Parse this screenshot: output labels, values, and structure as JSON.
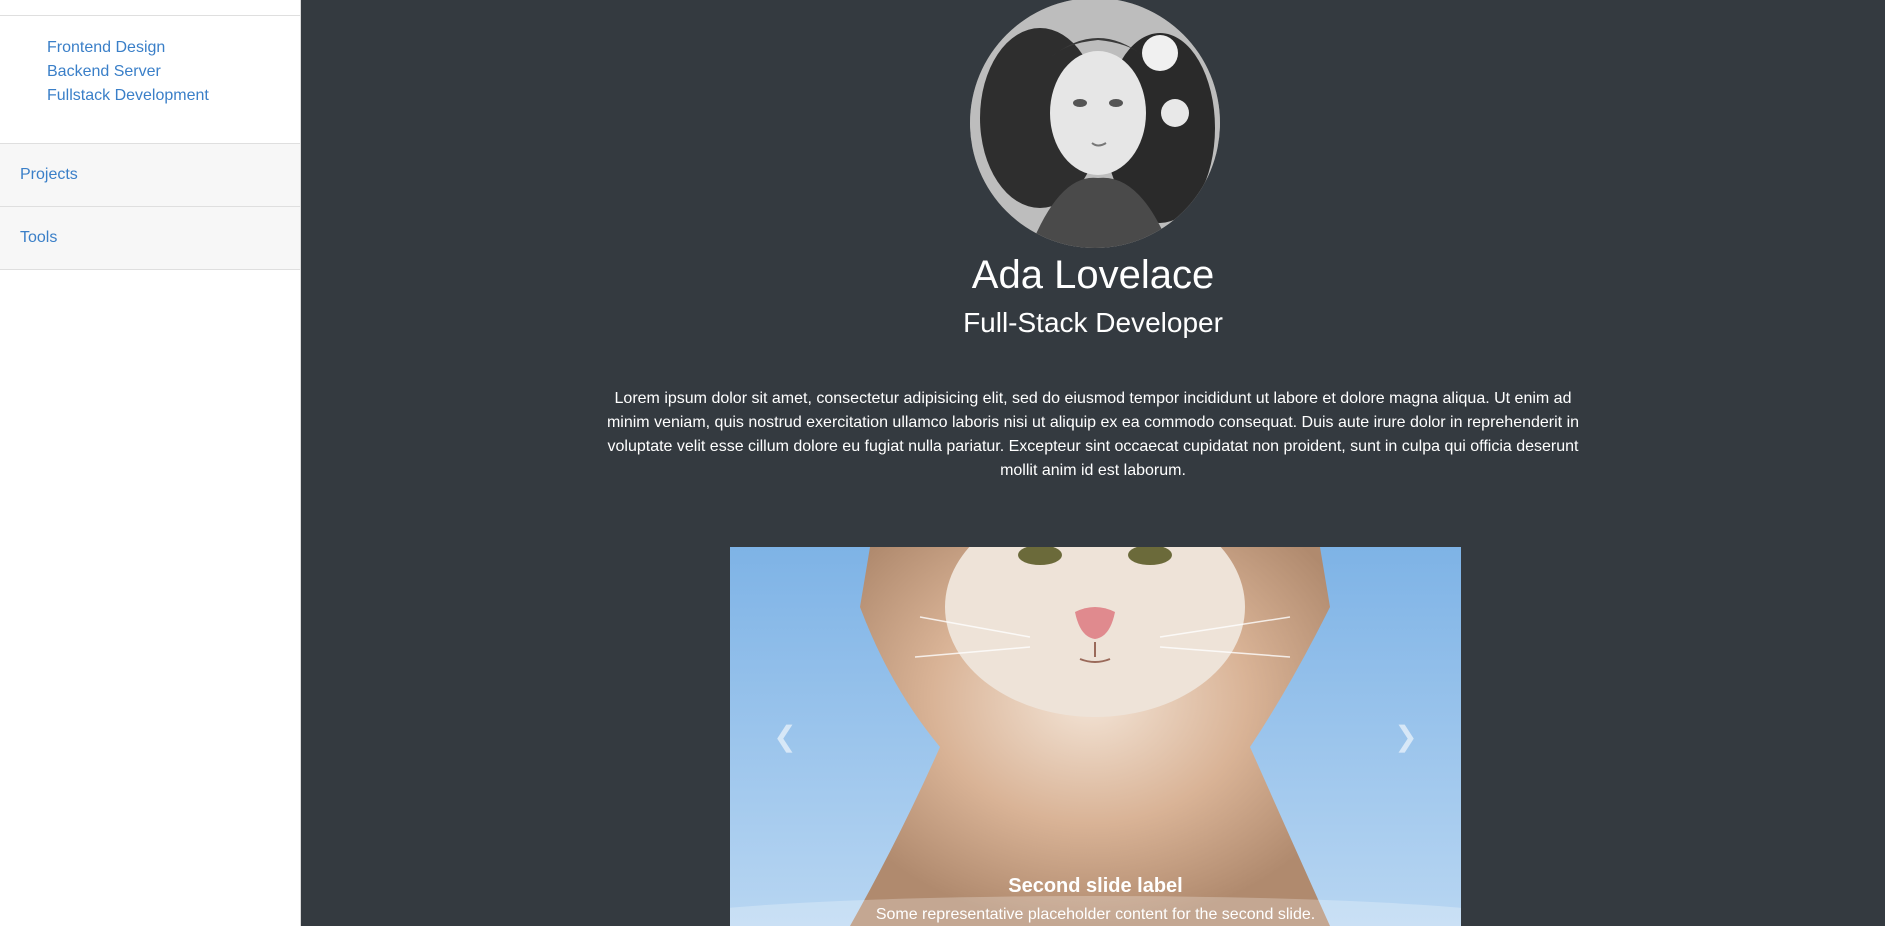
{
  "sidebar": {
    "sub_items": [
      {
        "label": "Frontend Design"
      },
      {
        "label": "Backend Server"
      },
      {
        "label": "Fullstack Development"
      }
    ],
    "sections": [
      {
        "label": "Projects"
      },
      {
        "label": "Tools"
      }
    ]
  },
  "profile": {
    "name": "Ada Lovelace",
    "title": "Full-Stack Developer",
    "bio": "Lorem ipsum dolor sit amet, consectetur adipisicing elit, sed do eiusmod tempor incididunt ut labore et dolore magna aliqua. Ut enim ad minim veniam, quis nostrud exercitation ullamco laboris nisi ut aliquip ex ea commodo consequat. Duis aute irure dolor in reprehenderit in voluptate velit esse cillum dolore eu fugiat nulla pariatur. Excepteur sint occaecat cupidatat non proident, sunt in culpa qui officia deserunt mollit anim id est laborum."
  },
  "carousel": {
    "prev_icon": "chevron-left-icon",
    "next_icon": "chevron-right-icon",
    "caption_title": "Second slide label",
    "caption_text": "Some representative placeholder content for the second slide."
  },
  "colors": {
    "main_background": "#343a40",
    "link": "#3a7fc8",
    "sidebar_section_background": "#f7f7f7"
  }
}
